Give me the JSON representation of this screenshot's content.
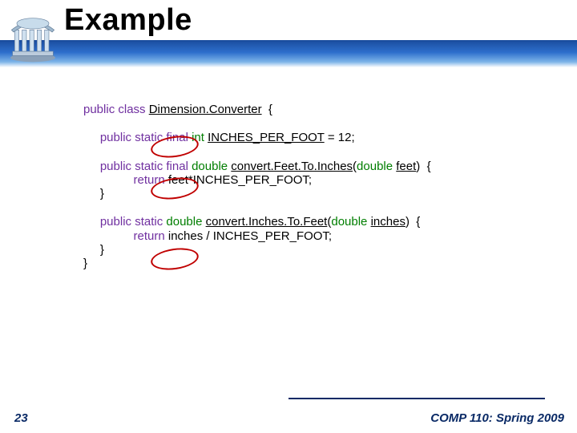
{
  "title": "Example",
  "page_number": "23",
  "course": "COMP 110: Spring 2009",
  "code": {
    "l1": {
      "kw": "public class ",
      "id": "Dimension.Converter",
      "tail": "  {"
    },
    "l2": {
      "kw1": "public ",
      "kw2": "static ",
      "kw3": "final ",
      "typ": "int ",
      "id": "INCHES_PER_FOOT",
      "tail": " = 12;"
    },
    "l3": {
      "kw1": "public ",
      "kw2": "static ",
      "kw3": "final ",
      "typ": "double ",
      "id": "convert.Feet.To.Inches",
      "paren1": "(",
      "ptyp": "double ",
      "pid": "feet",
      "paren2": ")",
      "tail": "  {"
    },
    "l4": {
      "kw": "return ",
      "expr": "feet*INCHES_PER_FOOT;"
    },
    "l5": "}",
    "l6": {
      "kw1": "public ",
      "kw2": "static ",
      "typ": "double ",
      "id": "convert.Inches.To.Feet",
      "paren1": "(",
      "ptyp": "double ",
      "pid": "inches",
      "paren2": ")",
      "tail": "  {"
    },
    "l7": {
      "kw": "return ",
      "expr": "inches / INCHES_PER_FOOT;"
    },
    "l8": "}",
    "l9": "}"
  }
}
